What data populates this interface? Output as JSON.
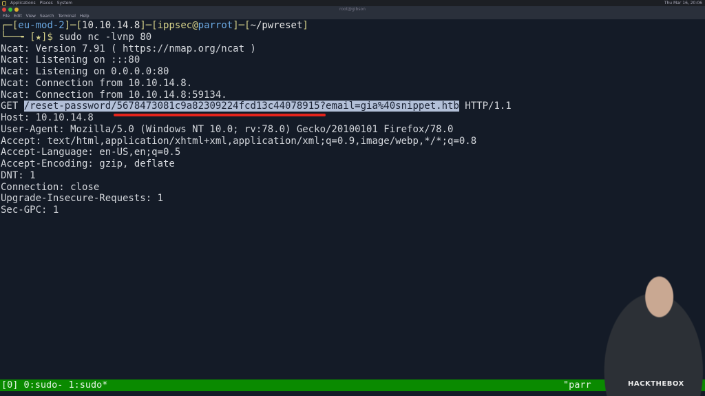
{
  "system_bar": {
    "menus": [
      "Applications",
      "Places",
      "System"
    ],
    "clock": "Thu Mar 16, 20:06"
  },
  "window": {
    "title": "root@gibson",
    "menus": [
      "File",
      "Edit",
      "View",
      "Search",
      "Terminal",
      "Help"
    ]
  },
  "prompt": {
    "session": "eu-mod-2",
    "ip": "10.10.14.8",
    "user": "ippsec",
    "host": "parrot",
    "cwd": "~/pwreset",
    "marker": "★",
    "command": "sudo nc -lvnp 80"
  },
  "output": {
    "pre": [
      "Ncat: Version 7.91 ( https://nmap.org/ncat )",
      "Ncat: Listening on :::80",
      "Ncat: Listening on 0.0.0.0:80",
      "Ncat: Connection from 10.10.14.8.",
      "Ncat: Connection from 10.10.14.8:59134."
    ],
    "get_method": "GET ",
    "get_path": "/reset-password/5678473081c9a82309224fcd13c44078915?email=gia%40snippet.htb",
    "get_proto": " HTTP/1.1",
    "post": [
      "Host: 10.10.14.8",
      "User-Agent: Mozilla/5.0 (Windows NT 10.0; rv:78.0) Gecko/20100101 Firefox/78.0",
      "Accept: text/html,application/xhtml+xml,application/xml;q=0.9,image/webp,*/*;q=0.8",
      "Accept-Language: en-US,en;q=0.5",
      "Accept-Encoding: gzip, deflate",
      "DNT: 1",
      "Connection: close",
      "Upgrade-Insecure-Requests: 1",
      "Sec-GPC: 1"
    ]
  },
  "tmux": {
    "windows": "[0] 0:sudo- 1:sudo*",
    "right": "\"parr"
  },
  "webcam": {
    "brand": "HACKTHEBOX"
  },
  "colors": {
    "status_green": "#0a8a00",
    "highlight_red": "#e5231b"
  }
}
